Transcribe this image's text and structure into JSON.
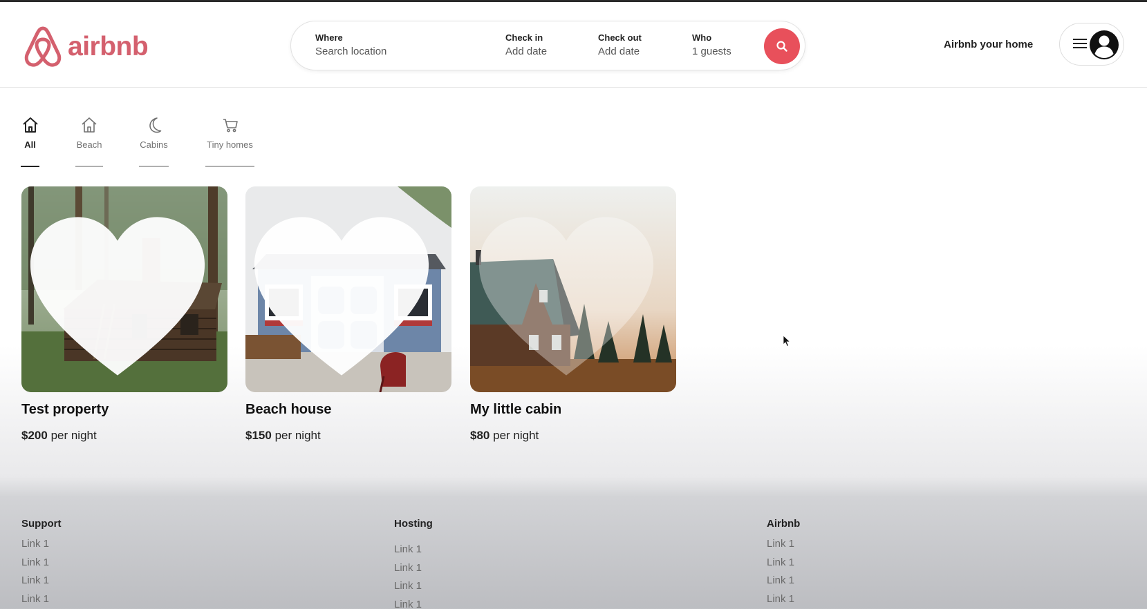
{
  "brand": {
    "name": "airbnb",
    "color": "#d4606e",
    "icon": "airbnb-logo-icon"
  },
  "search": {
    "where": {
      "label": "Where",
      "value": "Search location"
    },
    "checkin": {
      "label": "Check in",
      "value": "Add date"
    },
    "checkout": {
      "label": "Check out",
      "value": "Add date"
    },
    "who": {
      "label": "Who",
      "value": "1 guests"
    },
    "button_icon": "search-icon",
    "button_color": "#e8505b"
  },
  "header": {
    "host_link": "Airbnb your home",
    "menu_icon": "hamburger-icon",
    "avatar_icon": "user-avatar-icon"
  },
  "categories": [
    {
      "label": "All",
      "icon": "home-icon",
      "active": true
    },
    {
      "label": "Beach",
      "icon": "house-icon",
      "active": false
    },
    {
      "label": "Cabins",
      "icon": "moon-icon",
      "active": false
    },
    {
      "label": "Tiny homes",
      "icon": "cart-icon",
      "active": false
    }
  ],
  "listings": [
    {
      "title": "Test property",
      "price": "$200",
      "unit": "per night",
      "image": "log cabin in forest"
    },
    {
      "title": "Beach house",
      "price": "$150",
      "unit": "per night",
      "image": "blue tiny shed"
    },
    {
      "title": "My little cabin",
      "price": "$80",
      "unit": "per night",
      "image": "cabin at sunset"
    }
  ],
  "footer": {
    "support": {
      "title": "Support",
      "links": [
        "Link 1",
        "Link 1",
        "Link 1",
        "Link 1"
      ]
    },
    "hosting": {
      "title": "Hosting",
      "links": [
        "Link 1",
        "Link 1",
        "Link 1",
        "Link 1"
      ]
    },
    "airbnb": {
      "title": "Airbnb",
      "links": [
        "Link 1",
        "Link 1",
        "Link 1",
        "Link 1"
      ]
    }
  }
}
